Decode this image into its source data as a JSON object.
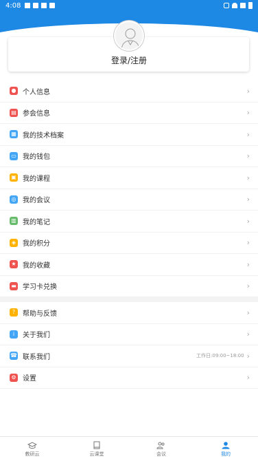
{
  "status_bar": {
    "time": "4:08"
  },
  "profile": {
    "login_label": "登录/注册"
  },
  "menu_groups": [
    [
      {
        "label": "个人信息",
        "icon": "person-icon",
        "color": "#ef5350"
      },
      {
        "label": "参会信息",
        "icon": "conference-icon",
        "color": "#ef5350"
      },
      {
        "label": "我的技术档案",
        "icon": "archive-icon",
        "color": "#42a5f5"
      },
      {
        "label": "我的钱包",
        "icon": "wallet-icon",
        "color": "#42a5f5"
      },
      {
        "label": "我的课程",
        "icon": "course-icon",
        "color": "#ffb300"
      },
      {
        "label": "我的会议",
        "icon": "meeting-icon",
        "color": "#42a5f5"
      },
      {
        "label": "我的笔记",
        "icon": "note-icon",
        "color": "#66bb6a"
      },
      {
        "label": "我的积分",
        "icon": "points-icon",
        "color": "#ffb300"
      },
      {
        "label": "我的收藏",
        "icon": "star-icon",
        "color": "#ef5350"
      },
      {
        "label": "学习卡兑换",
        "icon": "card-icon",
        "color": "#ef5350"
      }
    ],
    [
      {
        "label": "帮助与反馈",
        "icon": "help-icon",
        "color": "#ffb300"
      },
      {
        "label": "关于我们",
        "icon": "about-icon",
        "color": "#42a5f5"
      },
      {
        "label": "联系我们",
        "icon": "contact-icon",
        "color": "#42a5f5",
        "extra": "工作日:09:00~18:00"
      },
      {
        "label": "设置",
        "icon": "settings-icon",
        "color": "#ef5350"
      }
    ]
  ],
  "tabs": [
    {
      "label": "教研云",
      "icon": "graduation-cap-icon",
      "active": false
    },
    {
      "label": "云课堂",
      "icon": "book-icon",
      "active": false
    },
    {
      "label": "会议",
      "icon": "people-icon",
      "active": false
    },
    {
      "label": "我的",
      "icon": "profile-icon",
      "active": true
    }
  ],
  "colors": {
    "accent": "#1e88e5"
  }
}
